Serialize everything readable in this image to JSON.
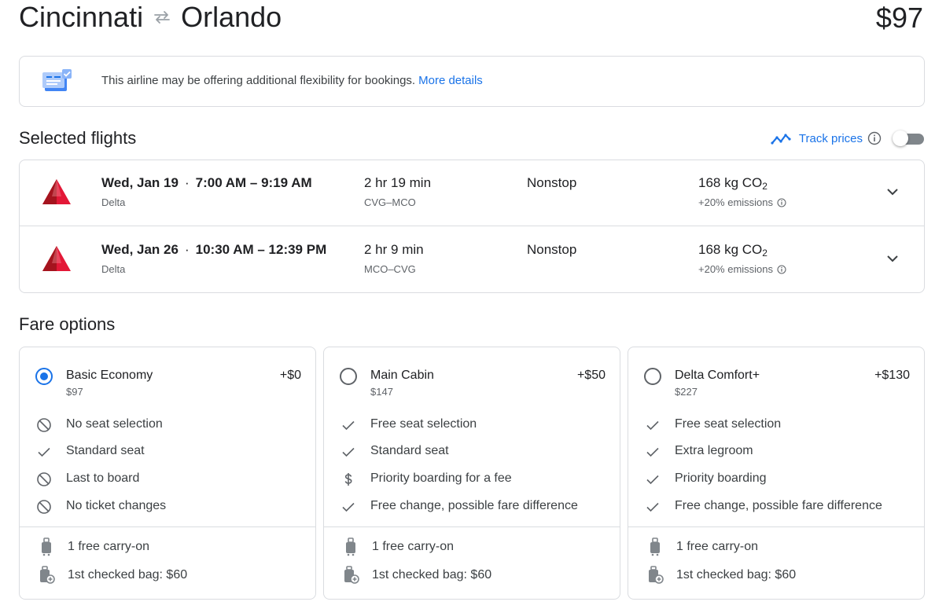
{
  "header": {
    "origin": "Cincinnati",
    "destination": "Orlando",
    "total_price": "$97"
  },
  "notice": {
    "text": "This airline may be offering additional flexibility for bookings.",
    "link": "More details"
  },
  "selected_flights": {
    "title": "Selected flights",
    "track_prices_label": "Track prices",
    "flights": [
      {
        "date": "Wed, Jan 19",
        "times": "7:00 AM – 9:19 AM",
        "airline": "Delta",
        "duration": "2 hr 19 min",
        "airports": "CVG–MCO",
        "stops": "Nonstop",
        "co2": "168 kg CO",
        "co2_sub": "2",
        "emissions": "+20% emissions"
      },
      {
        "date": "Wed, Jan 26",
        "times": "10:30 AM – 12:39 PM",
        "airline": "Delta",
        "duration": "2 hr 9 min",
        "airports": "MCO–CVG",
        "stops": "Nonstop",
        "co2": "168 kg CO",
        "co2_sub": "2",
        "emissions": "+20% emissions"
      }
    ]
  },
  "fare_options": {
    "title": "Fare options",
    "cards": [
      {
        "name": "Basic Economy",
        "price": "$97",
        "delta": "+$0",
        "selected": true,
        "features": [
          {
            "icon": "no-icon",
            "text": "No seat selection"
          },
          {
            "icon": "check-icon",
            "text": "Standard seat"
          },
          {
            "icon": "no-icon",
            "text": "Last to board"
          },
          {
            "icon": "no-icon",
            "text": "No ticket changes"
          }
        ],
        "bags": [
          "1 free carry-on",
          "1st checked bag: $60"
        ]
      },
      {
        "name": "Main Cabin",
        "price": "$147",
        "delta": "+$50",
        "selected": false,
        "features": [
          {
            "icon": "check-icon",
            "text": "Free seat selection"
          },
          {
            "icon": "check-icon",
            "text": "Standard seat"
          },
          {
            "icon": "dollar-icon",
            "text": "Priority boarding for a fee"
          },
          {
            "icon": "check-icon",
            "text": "Free change, possible fare difference"
          }
        ],
        "bags": [
          "1 free carry-on",
          "1st checked bag: $60"
        ]
      },
      {
        "name": "Delta Comfort+",
        "price": "$227",
        "delta": "+$130",
        "selected": false,
        "features": [
          {
            "icon": "check-icon",
            "text": "Free seat selection"
          },
          {
            "icon": "check-icon",
            "text": "Extra legroom"
          },
          {
            "icon": "check-icon",
            "text": "Priority boarding"
          },
          {
            "icon": "check-icon",
            "text": "Free change, possible fare difference"
          }
        ],
        "bags": [
          "1 free carry-on",
          "1st checked bag: $60"
        ]
      }
    ]
  },
  "colors": {
    "accent": "#1a73e8",
    "delta_red": "#c8102e",
    "border": "#dadce0",
    "secondary_text": "#5f6368"
  }
}
